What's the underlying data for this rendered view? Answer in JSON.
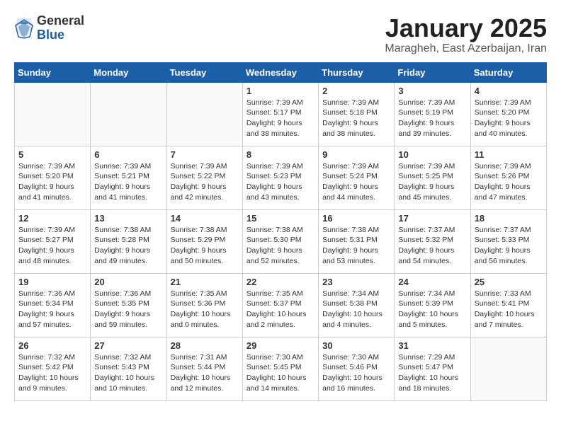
{
  "header": {
    "logo_general": "General",
    "logo_blue": "Blue",
    "month_title": "January 2025",
    "location": "Maragheh, East Azerbaijan, Iran"
  },
  "weekdays": [
    "Sunday",
    "Monday",
    "Tuesday",
    "Wednesday",
    "Thursday",
    "Friday",
    "Saturday"
  ],
  "weeks": [
    [
      {
        "day": "",
        "text": ""
      },
      {
        "day": "",
        "text": ""
      },
      {
        "day": "",
        "text": ""
      },
      {
        "day": "1",
        "text": "Sunrise: 7:39 AM\nSunset: 5:17 PM\nDaylight: 9 hours\nand 38 minutes."
      },
      {
        "day": "2",
        "text": "Sunrise: 7:39 AM\nSunset: 5:18 PM\nDaylight: 9 hours\nand 38 minutes."
      },
      {
        "day": "3",
        "text": "Sunrise: 7:39 AM\nSunset: 5:19 PM\nDaylight: 9 hours\nand 39 minutes."
      },
      {
        "day": "4",
        "text": "Sunrise: 7:39 AM\nSunset: 5:20 PM\nDaylight: 9 hours\nand 40 minutes."
      }
    ],
    [
      {
        "day": "5",
        "text": "Sunrise: 7:39 AM\nSunset: 5:20 PM\nDaylight: 9 hours\nand 41 minutes."
      },
      {
        "day": "6",
        "text": "Sunrise: 7:39 AM\nSunset: 5:21 PM\nDaylight: 9 hours\nand 41 minutes."
      },
      {
        "day": "7",
        "text": "Sunrise: 7:39 AM\nSunset: 5:22 PM\nDaylight: 9 hours\nand 42 minutes."
      },
      {
        "day": "8",
        "text": "Sunrise: 7:39 AM\nSunset: 5:23 PM\nDaylight: 9 hours\nand 43 minutes."
      },
      {
        "day": "9",
        "text": "Sunrise: 7:39 AM\nSunset: 5:24 PM\nDaylight: 9 hours\nand 44 minutes."
      },
      {
        "day": "10",
        "text": "Sunrise: 7:39 AM\nSunset: 5:25 PM\nDaylight: 9 hours\nand 45 minutes."
      },
      {
        "day": "11",
        "text": "Sunrise: 7:39 AM\nSunset: 5:26 PM\nDaylight: 9 hours\nand 47 minutes."
      }
    ],
    [
      {
        "day": "12",
        "text": "Sunrise: 7:39 AM\nSunset: 5:27 PM\nDaylight: 9 hours\nand 48 minutes."
      },
      {
        "day": "13",
        "text": "Sunrise: 7:38 AM\nSunset: 5:28 PM\nDaylight: 9 hours\nand 49 minutes."
      },
      {
        "day": "14",
        "text": "Sunrise: 7:38 AM\nSunset: 5:29 PM\nDaylight: 9 hours\nand 50 minutes."
      },
      {
        "day": "15",
        "text": "Sunrise: 7:38 AM\nSunset: 5:30 PM\nDaylight: 9 hours\nand 52 minutes."
      },
      {
        "day": "16",
        "text": "Sunrise: 7:38 AM\nSunset: 5:31 PM\nDaylight: 9 hours\nand 53 minutes."
      },
      {
        "day": "17",
        "text": "Sunrise: 7:37 AM\nSunset: 5:32 PM\nDaylight: 9 hours\nand 54 minutes."
      },
      {
        "day": "18",
        "text": "Sunrise: 7:37 AM\nSunset: 5:33 PM\nDaylight: 9 hours\nand 56 minutes."
      }
    ],
    [
      {
        "day": "19",
        "text": "Sunrise: 7:36 AM\nSunset: 5:34 PM\nDaylight: 9 hours\nand 57 minutes."
      },
      {
        "day": "20",
        "text": "Sunrise: 7:36 AM\nSunset: 5:35 PM\nDaylight: 9 hours\nand 59 minutes."
      },
      {
        "day": "21",
        "text": "Sunrise: 7:35 AM\nSunset: 5:36 PM\nDaylight: 10 hours\nand 0 minutes."
      },
      {
        "day": "22",
        "text": "Sunrise: 7:35 AM\nSunset: 5:37 PM\nDaylight: 10 hours\nand 2 minutes."
      },
      {
        "day": "23",
        "text": "Sunrise: 7:34 AM\nSunset: 5:38 PM\nDaylight: 10 hours\nand 4 minutes."
      },
      {
        "day": "24",
        "text": "Sunrise: 7:34 AM\nSunset: 5:39 PM\nDaylight: 10 hours\nand 5 minutes."
      },
      {
        "day": "25",
        "text": "Sunrise: 7:33 AM\nSunset: 5:41 PM\nDaylight: 10 hours\nand 7 minutes."
      }
    ],
    [
      {
        "day": "26",
        "text": "Sunrise: 7:32 AM\nSunset: 5:42 PM\nDaylight: 10 hours\nand 9 minutes."
      },
      {
        "day": "27",
        "text": "Sunrise: 7:32 AM\nSunset: 5:43 PM\nDaylight: 10 hours\nand 10 minutes."
      },
      {
        "day": "28",
        "text": "Sunrise: 7:31 AM\nSunset: 5:44 PM\nDaylight: 10 hours\nand 12 minutes."
      },
      {
        "day": "29",
        "text": "Sunrise: 7:30 AM\nSunset: 5:45 PM\nDaylight: 10 hours\nand 14 minutes."
      },
      {
        "day": "30",
        "text": "Sunrise: 7:30 AM\nSunset: 5:46 PM\nDaylight: 10 hours\nand 16 minutes."
      },
      {
        "day": "31",
        "text": "Sunrise: 7:29 AM\nSunset: 5:47 PM\nDaylight: 10 hours\nand 18 minutes."
      },
      {
        "day": "",
        "text": ""
      }
    ]
  ]
}
